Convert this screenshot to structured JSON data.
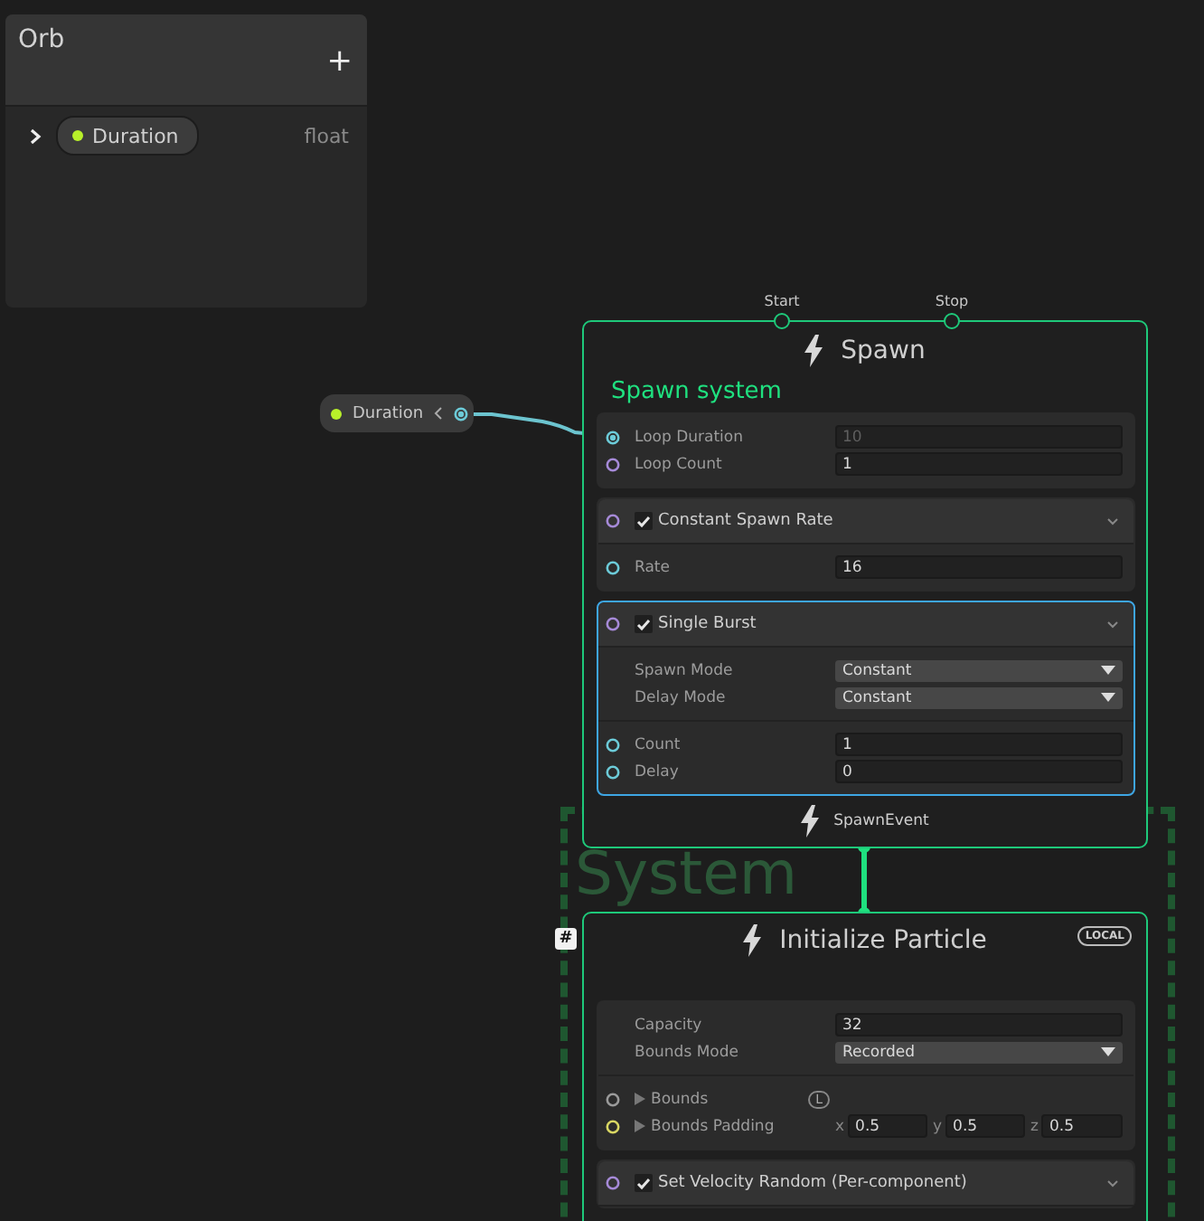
{
  "blackboard": {
    "title": "Orb",
    "add_button": "+",
    "properties": [
      {
        "name": "Duration",
        "type": "float",
        "expanded": false,
        "color": "#b8f02a"
      }
    ]
  },
  "property_node": {
    "name": "Duration",
    "color": "#b8f02a",
    "port": {
      "color": "#6ccbd8",
      "connected": true
    }
  },
  "system": {
    "label": "System"
  },
  "spawn_context": {
    "title": "Spawn",
    "flow_inputs": [
      "Start",
      "Stop"
    ],
    "subtitle": "Spawn system",
    "blocks": [
      {
        "selected": false,
        "sections": [
          [
            {
              "kind": "field",
              "label": "Loop Duration",
              "value": "10",
              "port": {
                "color": "#6ccbd8",
                "connected": true
              },
              "disabled": true
            },
            {
              "kind": "field",
              "label": "Loop Count",
              "value": "1",
              "port": {
                "color": "#a68ad8",
                "connected": false
              },
              "disabled": false
            }
          ]
        ]
      },
      {
        "title": "Constant Spawn Rate",
        "enabled": true,
        "selected": false,
        "port": {
          "color": "#a68ad8"
        },
        "sections": [
          [
            {
              "kind": "field",
              "label": "Rate",
              "value": "16",
              "port": {
                "color": "#6ccbd8",
                "connected": false
              },
              "disabled": false
            }
          ]
        ]
      },
      {
        "title": "Single Burst",
        "enabled": true,
        "selected": true,
        "port": {
          "color": "#a68ad8"
        },
        "sections": [
          [
            {
              "kind": "dropdown",
              "label": "Spawn Mode",
              "value": "Constant"
            },
            {
              "kind": "dropdown",
              "label": "Delay Mode",
              "value": "Constant"
            }
          ],
          [
            {
              "kind": "field",
              "label": "Count",
              "value": "1",
              "port": {
                "color": "#6ccbd8",
                "connected": false
              },
              "disabled": false
            },
            {
              "kind": "field",
              "label": "Delay",
              "value": "0",
              "port": {
                "color": "#6ccbd8",
                "connected": false
              },
              "disabled": false
            }
          ]
        ]
      }
    ],
    "flow_output": "SpawnEvent"
  },
  "initialize_context": {
    "title": "Initialize Particle",
    "space_badge": "LOCAL",
    "marker": "#",
    "blocks": [
      {
        "selected": false,
        "sections": [
          [
            {
              "kind": "field",
              "label": "Capacity",
              "value": "32",
              "disabled": false
            },
            {
              "kind": "dropdown",
              "label": "Bounds Mode",
              "value": "Recorded"
            }
          ],
          [
            {
              "kind": "collapsed",
              "label": "Bounds",
              "port": {
                "color": "#9a9a9a",
                "connected": false
              },
              "space": "L"
            },
            {
              "kind": "vector3",
              "label": "Bounds Padding",
              "port": {
                "color": "#d9d763",
                "connected": false
              },
              "values": [
                {
                  "axis": "x",
                  "value": "0.5"
                },
                {
                  "axis": "y",
                  "value": "0.5"
                },
                {
                  "axis": "z",
                  "value": "0.5"
                }
              ]
            }
          ]
        ]
      },
      {
        "title": "Set Velocity Random (Per-component)",
        "enabled": true,
        "selected": false,
        "port": {
          "color": "#a68ad8"
        }
      }
    ]
  }
}
